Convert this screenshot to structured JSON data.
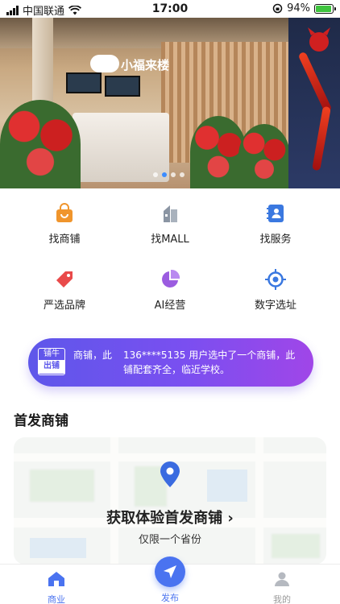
{
  "status_bar": {
    "carrier": "中国联通",
    "time": "17:00",
    "battery_percent": "94%",
    "battery_level": 0.94
  },
  "banner": {
    "store_sign": "小福来楼",
    "slide_count": 4,
    "active_slide": 1
  },
  "categories": [
    {
      "label": "找商铺",
      "icon": "shopping-bag-icon",
      "color": "#f0952c"
    },
    {
      "label": "找MALL",
      "icon": "building-icon",
      "color": "#7d8896"
    },
    {
      "label": "找服务",
      "icon": "contact-book-icon",
      "color": "#3a78e0"
    },
    {
      "label": "严选品牌",
      "icon": "tag-icon",
      "color": "#e94a4a"
    },
    {
      "label": "AI经营",
      "icon": "pie-chart-icon",
      "color": "#9b5ce0"
    },
    {
      "label": "数字选址",
      "icon": "target-icon",
      "color": "#3a78e0"
    }
  ],
  "notice": {
    "badge_top": "铺牛",
    "badge_bottom": "出铺",
    "prefix": "商铺，此",
    "text": "136****5135 用户选中了一个商铺，此铺配套齐全，临近学校。"
  },
  "section": {
    "title": "首发商铺",
    "card_title": "获取体验首发商铺",
    "card_arrow": "›",
    "card_subtitle": "仅限一个省份"
  },
  "bottom_nav": {
    "items": [
      {
        "label": "商业",
        "icon": "home-icon",
        "active": true
      },
      {
        "label": "发布",
        "icon": "send-icon",
        "active": false
      },
      {
        "label": "我的",
        "icon": "user-icon",
        "active": false
      }
    ]
  },
  "colors": {
    "accent": "#4a73f0",
    "notice_gradient_start": "#5e57ea",
    "notice_gradient_end": "#a046e8",
    "pin": "#3a6be0"
  }
}
